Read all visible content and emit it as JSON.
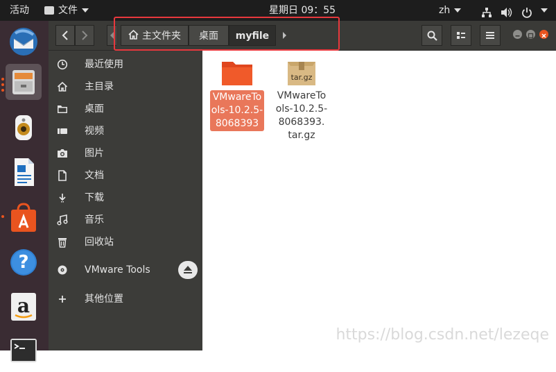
{
  "topbar": {
    "activities": "活动",
    "app_menu": "文件",
    "clock": "星期日 09：55",
    "input_method": "zh"
  },
  "dock": {
    "apps": [
      {
        "name": "Thunderbird"
      },
      {
        "name": "Files"
      },
      {
        "name": "Rhythmbox"
      },
      {
        "name": "LibreOffice Writer"
      },
      {
        "name": "Ubuntu Software"
      },
      {
        "name": "Help"
      },
      {
        "name": "Amazon"
      },
      {
        "name": "Terminal"
      }
    ]
  },
  "header": {
    "breadcrumbs": [
      "主文件夹",
      "桌面",
      "myfile"
    ]
  },
  "sidebar": {
    "items": [
      {
        "label": "最近使用",
        "icon": "clock-icon"
      },
      {
        "label": "主目录",
        "icon": "home-icon"
      },
      {
        "label": "桌面",
        "icon": "folder-icon"
      },
      {
        "label": "视频",
        "icon": "video-icon"
      },
      {
        "label": "图片",
        "icon": "camera-icon"
      },
      {
        "label": "文档",
        "icon": "document-icon"
      },
      {
        "label": "下载",
        "icon": "download-icon"
      },
      {
        "label": "音乐",
        "icon": "music-icon"
      },
      {
        "label": "回收站",
        "icon": "trash-icon"
      },
      {
        "label": "VMware Tools",
        "icon": "disc-icon"
      },
      {
        "label": "其他位置",
        "icon": "plus-icon"
      }
    ]
  },
  "files": [
    {
      "name_lines": [
        "VMwareTo",
        "ols-10.2.5-",
        "8068393"
      ],
      "type": "folder",
      "selected": true
    },
    {
      "name_lines": [
        "VMwareTo",
        "ols-10.2.5-",
        "8068393.",
        "tar.gz"
      ],
      "type": "archive",
      "icon_label": "tar.gz",
      "selected": false
    }
  ],
  "watermark": "https://blog.csdn.net/lezeqe",
  "colors": {
    "accent": "#e9541f",
    "selection": "#e9775a",
    "highlight_box": "#e8383d"
  }
}
